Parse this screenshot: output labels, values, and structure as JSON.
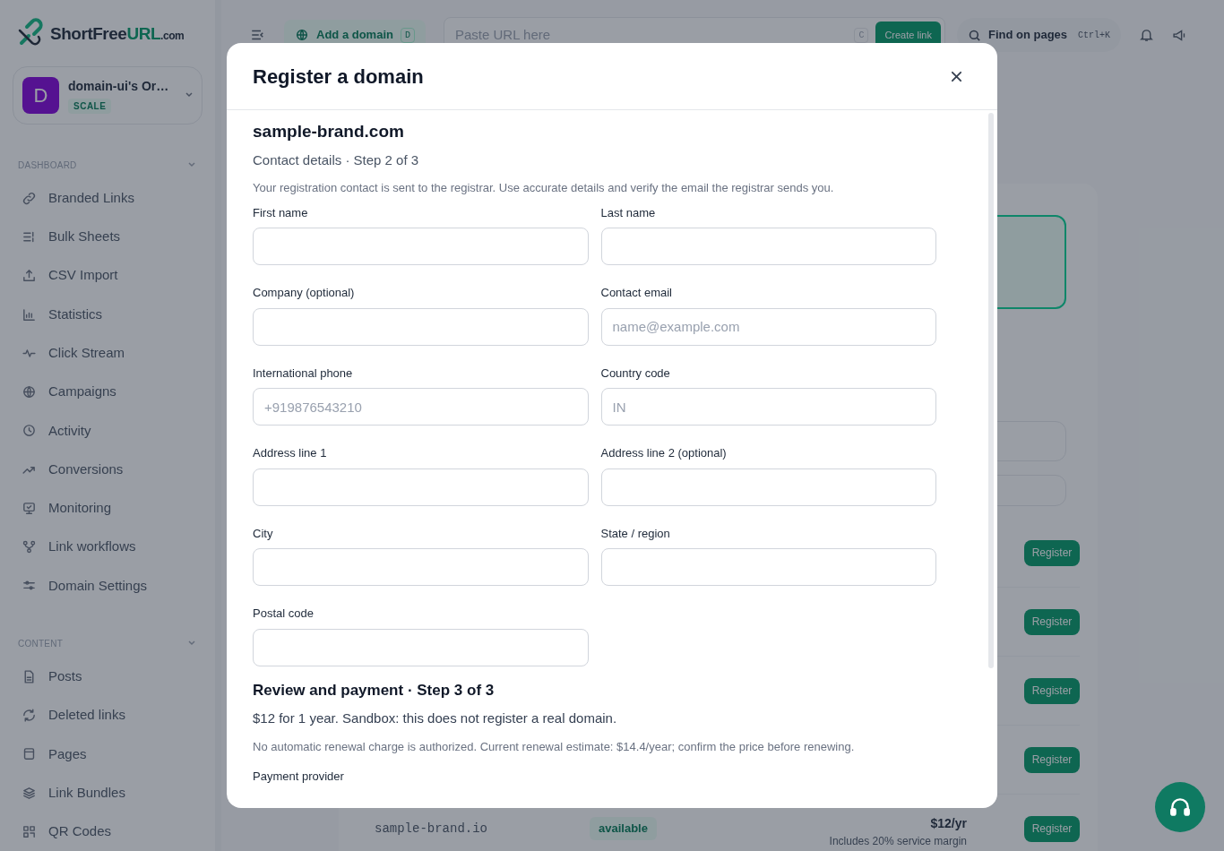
{
  "sidebar": {
    "logo": {
      "parts": [
        "ShortFree",
        "URL",
        ".com"
      ]
    },
    "org": {
      "initial": "D",
      "name": "domain-ui's Or…",
      "plan": "SCALE"
    },
    "sections": [
      {
        "title": "DASHBOARD",
        "items": [
          {
            "label": "Branded Links"
          },
          {
            "label": "Bulk Sheets"
          },
          {
            "label": "CSV Import"
          },
          {
            "label": "Statistics"
          },
          {
            "label": "Click Stream"
          },
          {
            "label": "Campaigns"
          },
          {
            "label": "Activity"
          },
          {
            "label": "Conversions"
          },
          {
            "label": "Monitoring"
          },
          {
            "label": "Link workflows"
          },
          {
            "label": "Domain Settings"
          }
        ]
      },
      {
        "title": "CONTENT",
        "items": [
          {
            "label": "Posts"
          },
          {
            "label": "Deleted links"
          },
          {
            "label": "Pages"
          },
          {
            "label": "Link Bundles"
          },
          {
            "label": "QR Codes"
          }
        ]
      }
    ]
  },
  "topbar": {
    "add_domain": {
      "label": "Add a domain",
      "key": "D"
    },
    "url": {
      "placeholder": "Paste URL here",
      "key": "C",
      "button": "Create link"
    },
    "search": {
      "label": "Find on pages",
      "shortcut": "Ctrl+K"
    }
  },
  "results": [
    {
      "button": "Register"
    },
    {
      "button": "Register"
    },
    {
      "button": "Register"
    },
    {
      "button": "Register"
    },
    {
      "domain": "sample-brand.io",
      "status": "available",
      "price": "$12/yr",
      "note": "Includes 20% service margin",
      "button": "Register"
    }
  ],
  "modal": {
    "title": "Register a domain",
    "domain": "sample-brand.com",
    "step": "Contact details · Step 2 of 3",
    "note": "Your registration contact is sent to the registrar. Use accurate details and verify the email the registrar sends you.",
    "fields": [
      {
        "label": "First name"
      },
      {
        "label": "Last name"
      },
      {
        "label": "Company (optional)"
      },
      {
        "label": "Contact email",
        "placeholder": "name@example.com"
      },
      {
        "label": "International phone",
        "placeholder": "+919876543210"
      },
      {
        "label": "Country code",
        "placeholder": "IN"
      },
      {
        "label": "Address line 1"
      },
      {
        "label": "Address line 2 (optional)"
      },
      {
        "label": "City"
      },
      {
        "label": "State / region"
      },
      {
        "label": "Postal code"
      }
    ],
    "review": {
      "title": "Review and payment · Step 3 of 3",
      "summary": "$12 for 1 year. Sandbox: this does not register a real domain.",
      "note": "No automatic renewal charge is authorized. Current renewal estimate: $14.4/year; confirm the price before renewing.",
      "payment_label": "Payment provider"
    }
  }
}
